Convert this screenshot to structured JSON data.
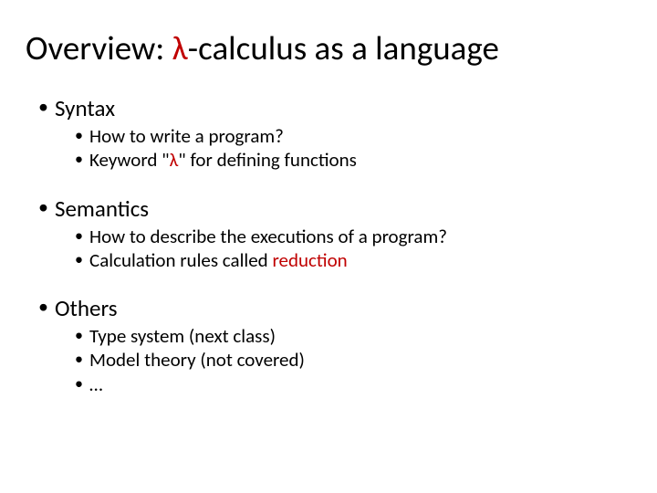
{
  "title_pre": "Overview: ",
  "title_lambda": "λ",
  "title_post": "-calculus as a language",
  "sections": {
    "syntax": {
      "heading": "Syntax",
      "items": {
        "i1": "How to write a program?",
        "i2_pre": "Keyword \"",
        "i2_lambda": "λ",
        "i2_post": "\" for defining functions"
      }
    },
    "semantics": {
      "heading": "Semantics",
      "items": {
        "i1": "How to describe the executions of a program?",
        "i2_pre": "Calculation rules called ",
        "i2_red": "reduction"
      }
    },
    "others": {
      "heading": "Others",
      "items": {
        "i1": "Type system (next class)",
        "i2": "Model theory (not covered)",
        "i3": "…"
      }
    }
  }
}
